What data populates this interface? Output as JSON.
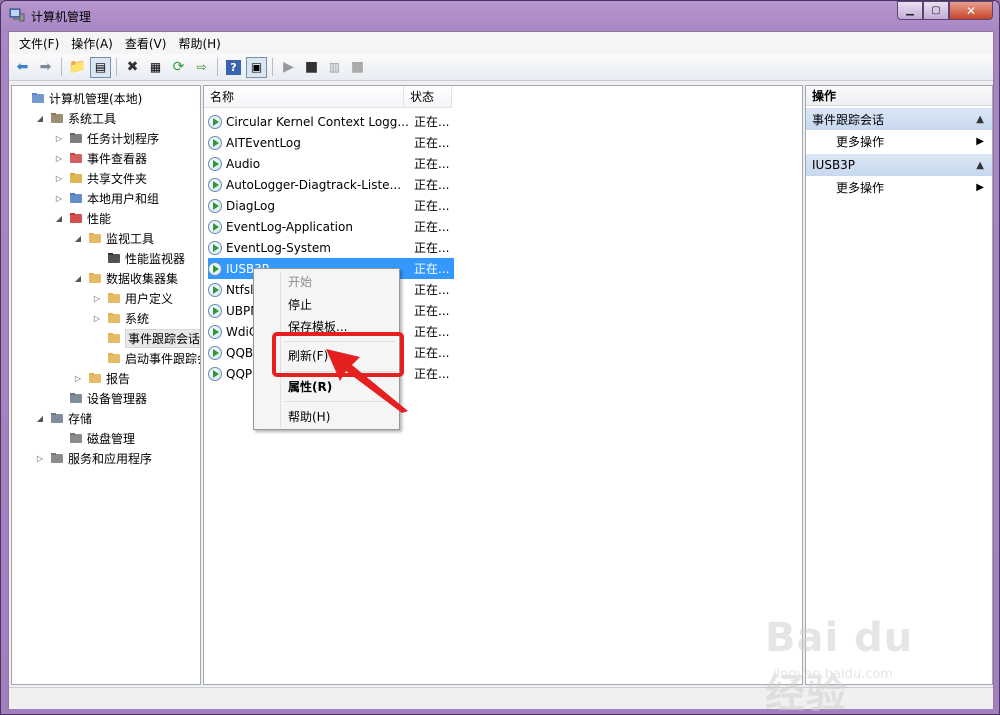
{
  "window": {
    "title": "计算机管理"
  },
  "menubar": [
    {
      "label": "文件(F)"
    },
    {
      "label": "操作(A)"
    },
    {
      "label": "查看(V)"
    },
    {
      "label": "帮助(H)"
    }
  ],
  "tree": [
    {
      "label": "计算机管理(本地)",
      "level": 0,
      "expander": "",
      "icon": "computer-management-icon"
    },
    {
      "label": "系统工具",
      "level": 1,
      "expander": "◢",
      "icon": "system-tools-icon"
    },
    {
      "label": "任务计划程序",
      "level": 2,
      "expander": "▷",
      "icon": "clock-icon"
    },
    {
      "label": "事件查看器",
      "level": 2,
      "expander": "▷",
      "icon": "event-viewer-icon"
    },
    {
      "label": "共享文件夹",
      "level": 2,
      "expander": "▷",
      "icon": "shared-folder-icon"
    },
    {
      "label": "本地用户和组",
      "level": 2,
      "expander": "▷",
      "icon": "users-icon"
    },
    {
      "label": "性能",
      "level": 2,
      "expander": "◢",
      "icon": "performance-icon"
    },
    {
      "label": "监视工具",
      "level": 3,
      "expander": "◢",
      "icon": "folder-icon"
    },
    {
      "label": "性能监视器",
      "level": 4,
      "expander": "",
      "icon": "monitor-icon"
    },
    {
      "label": "数据收集器集",
      "level": 3,
      "expander": "◢",
      "icon": "folder-icon"
    },
    {
      "label": "用户定义",
      "level": 4,
      "expander": "▷",
      "icon": "folder-icon"
    },
    {
      "label": "系统",
      "level": 4,
      "expander": "▷",
      "icon": "folder-icon"
    },
    {
      "label": "事件跟踪会话",
      "level": 4,
      "expander": "",
      "icon": "folder-icon",
      "selected": true
    },
    {
      "label": "启动事件跟踪会话",
      "level": 4,
      "expander": "",
      "icon": "folder-icon"
    },
    {
      "label": "报告",
      "level": 3,
      "expander": "▷",
      "icon": "folder-icon"
    },
    {
      "label": "设备管理器",
      "level": 2,
      "expander": "",
      "icon": "device-manager-icon"
    },
    {
      "label": "存储",
      "level": 1,
      "expander": "◢",
      "icon": "storage-icon"
    },
    {
      "label": "磁盘管理",
      "level": 2,
      "expander": "",
      "icon": "disk-icon"
    },
    {
      "label": "服务和应用程序",
      "level": 1,
      "expander": "▷",
      "icon": "services-icon"
    }
  ],
  "list": {
    "columns": [
      "名称",
      "状态"
    ],
    "rows": [
      {
        "name": "Circular Kernel Context Logg...",
        "status": "正在..."
      },
      {
        "name": "AITEventLog",
        "status": "正在..."
      },
      {
        "name": "Audio",
        "status": "正在..."
      },
      {
        "name": "AutoLogger-Diagtrack-Liste...",
        "status": "正在..."
      },
      {
        "name": "DiagLog",
        "status": "正在..."
      },
      {
        "name": "EventLog-Application",
        "status": "正在..."
      },
      {
        "name": "EventLog-System",
        "status": "正在..."
      },
      {
        "name": "IUSB3P",
        "status": "正在...",
        "selected": true
      },
      {
        "name": "Ntfsl",
        "status": "正在..."
      },
      {
        "name": "UBPM",
        "status": "正在..."
      },
      {
        "name": "WdiC",
        "status": "正在..."
      },
      {
        "name": "QQB",
        "status": "正在..."
      },
      {
        "name": "QQP",
        "status": "正在..."
      }
    ]
  },
  "actions": {
    "title": "操作",
    "groups": [
      {
        "label": "事件跟踪会话",
        "more": "更多操作"
      },
      {
        "label": "IUSB3P",
        "more": "更多操作"
      }
    ]
  },
  "context_menu": {
    "start": "开始",
    "stop": "停止",
    "save_template": "保存模板...",
    "refresh": "刷新(F)",
    "properties": "属性(R)",
    "help": "帮助(H)"
  },
  "watermark": {
    "big": "Bai du 经验",
    "small": "jingyan.baidu.com"
  },
  "colors": {
    "selection": "#3399ff",
    "annotation": "#e52020",
    "frame": "#a887c4"
  }
}
